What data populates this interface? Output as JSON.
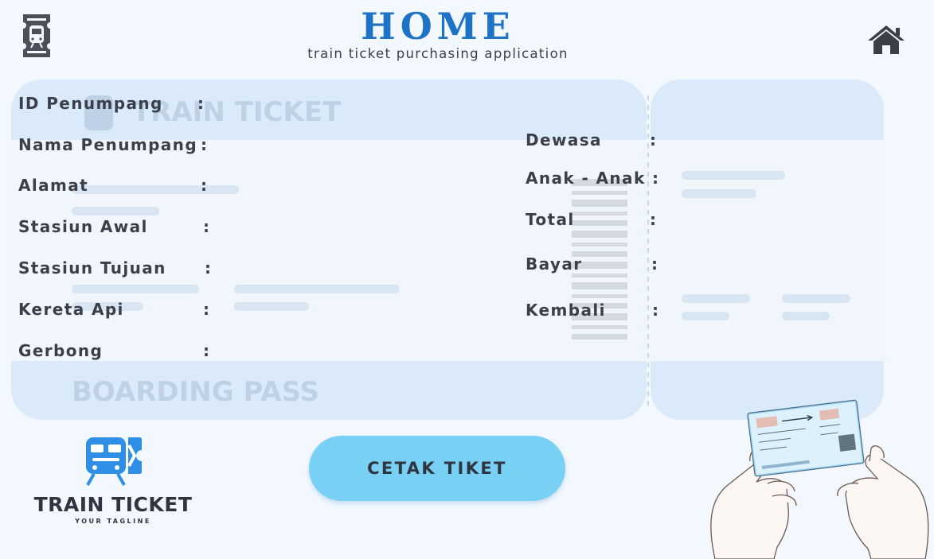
{
  "header": {
    "title": "HOME",
    "subtitle": "train ticket purchasing application"
  },
  "ticket_background": {
    "heading": "TRAIN TICKET",
    "footer": "BOARDING PASS"
  },
  "form_left": [
    {
      "label": "ID Penumpang",
      "colon": ":"
    },
    {
      "label": "Nama Penumpang",
      "colon": ":"
    },
    {
      "label": "Alamat",
      "colon": ":"
    },
    {
      "label": "Stasiun Awal",
      "colon": ":"
    },
    {
      "label": "Stasiun Tujuan",
      "colon": ":"
    },
    {
      "label": "Kereta Api",
      "colon": ":"
    },
    {
      "label": "Gerbong",
      "colon": ":"
    }
  ],
  "form_right": [
    {
      "label": "Dewasa",
      "colon": ":"
    },
    {
      "label": "Anak - Anak",
      "colon": ":"
    },
    {
      "label": "Total",
      "colon": ":"
    },
    {
      "label": "Bayar",
      "colon": ":"
    },
    {
      "label": "Kembali",
      "colon": ":"
    }
  ],
  "actions": {
    "print_label": "CETAK TIKET"
  },
  "logo": {
    "name": "TRAIN TICKET",
    "tagline": "YOUR TAGLINE"
  },
  "icons": {
    "app": "train-ticket-icon",
    "home": "home-icon",
    "logo": "train-ticket-logo-icon"
  },
  "colors": {
    "title": "#1f73c6",
    "button": "#79d0f5",
    "logo_blue": "#2f8fe6",
    "background": "#f2f8fd"
  }
}
